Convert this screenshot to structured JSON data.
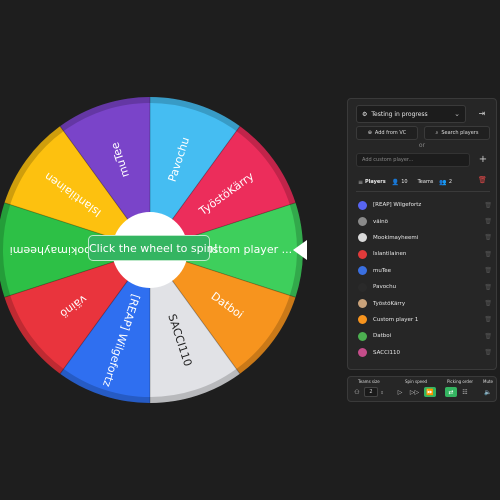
{
  "wheel": {
    "hint": "Click the wheel to spin!",
    "segments": [
      {
        "label": "Custom player ...",
        "color": "#3ecf5c"
      },
      {
        "label": "Datboi",
        "color": "#f7941e"
      },
      {
        "label": "SACCI110",
        "color": "#e1e2e6"
      },
      {
        "label": "[REAP] Wilgefortz",
        "color": "#2f6ff0"
      },
      {
        "label": "väinö",
        "color": "#e9343d"
      },
      {
        "label": "Mookimayheemi",
        "color": "#2dc046"
      },
      {
        "label": "Islantilainen",
        "color": "#fdc10f"
      },
      {
        "label": "muTee",
        "color": "#7a44c9"
      },
      {
        "label": "Pavochu",
        "color": "#45bdf2"
      },
      {
        "label": "TyöstöKärry",
        "color": "#ec2d5b"
      }
    ]
  },
  "panel": {
    "status": "Testing in progress",
    "add_vc": "Add from VC",
    "search_players": "Search players",
    "or": "or",
    "custom_placeholder": "Add custom player...",
    "players_tab": "Players",
    "players_count": "10",
    "teams_tab": "Teams",
    "teams_count": "2",
    "players": [
      {
        "name": "[REAP] Wilgefortz",
        "avatar": "#5865f2"
      },
      {
        "name": "väinö",
        "avatar": "#8a8a8a"
      },
      {
        "name": "Mookimayheemi",
        "avatar": "#d9d9d9"
      },
      {
        "name": "Islantilainen",
        "avatar": "#e03a3a"
      },
      {
        "name": "muTee",
        "avatar": "#3a6fe0"
      },
      {
        "name": "Pavochu",
        "avatar": "#2a2a2a"
      },
      {
        "name": "TyöstöKärry",
        "avatar": "#c9a27a"
      },
      {
        "name": "Custom player 1",
        "avatar": "#f7941e"
      },
      {
        "name": "Datboi",
        "avatar": "#4caf50"
      },
      {
        "name": "SACCI110",
        "avatar": "#c44d8a"
      }
    ]
  },
  "bottom": {
    "teams_size": "Teams size",
    "teams_size_value": "2",
    "spin_speed": "Spin speed",
    "picking_order": "Picking order",
    "mute": "Mute"
  }
}
